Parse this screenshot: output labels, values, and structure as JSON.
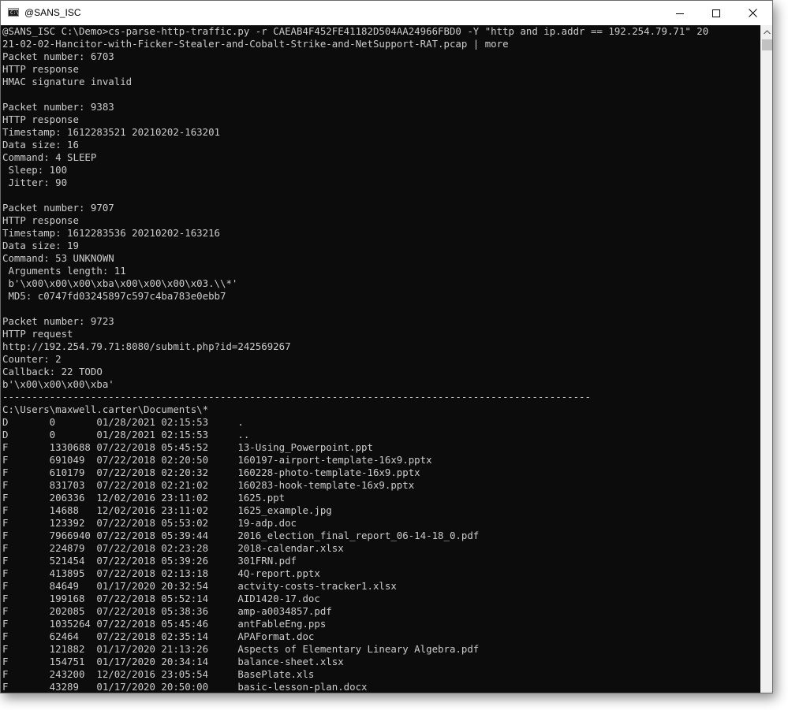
{
  "window": {
    "title": "@SANS_ISC",
    "icon_label": "C:\\"
  },
  "icons": {
    "app": "console-icon",
    "minimize": "minimize-icon",
    "maximize": "maximize-icon",
    "close": "close-icon",
    "scroll_up": "scroll-up-arrow-icon"
  },
  "colors": {
    "console_background": "#0c0c0c",
    "console_text": "#cccccc",
    "titlebar": "#ffffff",
    "scrollbar_track": "#f0f0f0",
    "scrollbar_thumb": "#c2c2c2"
  },
  "console": {
    "lines": [
      "@SANS_ISC C:\\Demo>cs-parse-http-traffic.py -r CAEAB4F452FE41182D504AA24966FBD0 -Y \"http and ip.addr == 192.254.79.71\" 20",
      "21-02-02-Hancitor-with-Ficker-Stealer-and-Cobalt-Strike-and-NetSupport-RAT.pcap | more",
      "Packet number: 6703",
      "HTTP response",
      "HMAC signature invalid",
      "",
      "Packet number: 9383",
      "HTTP response",
      "Timestamp: 1612283521 20210202-163201",
      "Data size: 16",
      "Command: 4 SLEEP",
      " Sleep: 100",
      " Jitter: 90",
      "",
      "Packet number: 9707",
      "HTTP response",
      "Timestamp: 1612283536 20210202-163216",
      "Data size: 19",
      "Command: 53 UNKNOWN",
      " Arguments length: 11",
      " b'\\x00\\x00\\x00\\xba\\x00\\x00\\x00\\x03.\\\\*'",
      " MD5: c0747fd03245897c597c4ba783e0ebb7",
      "",
      "Packet number: 9723",
      "HTTP request",
      "http://192.254.79.71:8080/submit.php?id=242569267",
      "Counter: 2",
      "Callback: 22 TODO",
      "b'\\x00\\x00\\x00\\xba'",
      "----------------------------------------------------------------------------------------------------",
      "C:\\Users\\maxwell.carter\\Documents\\*",
      "D       0       01/28/2021 02:15:53     .",
      "D       0       01/28/2021 02:15:53     ..",
      "F       1330688 07/22/2018 05:45:52     13-Using_Powerpoint.ppt",
      "F       691049  07/22/2018 02:20:50     160197-airport-template-16x9.pptx",
      "F       610179  07/22/2018 02:20:32     160228-photo-template-16x9.pptx",
      "F       831703  07/22/2018 02:21:02     160283-hook-template-16x9.pptx",
      "F       206336  12/02/2016 23:11:02     1625.ppt",
      "F       14688   12/02/2016 23:11:02     1625_example.jpg",
      "F       123392  07/22/2018 05:53:02     19-adp.doc",
      "F       7966940 07/22/2018 05:39:44     2016_election_final_report_06-14-18_0.pdf",
      "F       224879  07/22/2018 02:23:28     2018-calendar.xlsx",
      "F       521454  07/22/2018 05:39:26     301FRN.pdf",
      "F       413895  07/22/2018 02:13:18     4Q-report.pptx",
      "F       84649   01/17/2020 20:32:54     actvity-costs-tracker1.xlsx",
      "F       199168  07/22/2018 05:52:14     AID1420-17.doc",
      "F       202085  07/22/2018 05:38:36     amp-a0034857.pdf",
      "F       1035264 07/22/2018 05:45:46     antFableEng.pps",
      "F       62464   07/22/2018 02:35:14     APAFormat.doc",
      "F       121882  01/17/2020 21:13:26     Aspects of Elementary Lineary Algebra.pdf",
      "F       154751  01/17/2020 20:34:14     balance-sheet.xlsx",
      "F       243200  12/02/2016 23:05:54     BasePlate.xls",
      "F       43289   01/17/2020 20:50:00     basic-lesson-plan.docx"
    ]
  }
}
